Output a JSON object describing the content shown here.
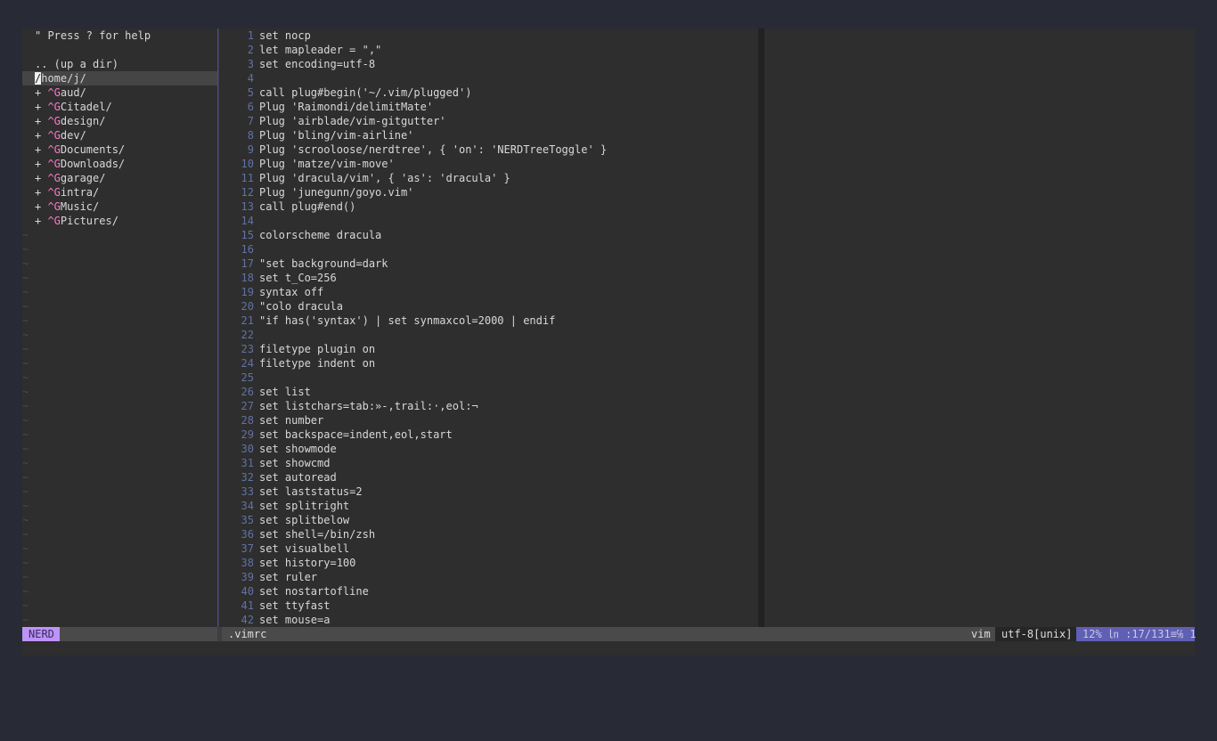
{
  "nerdtree": {
    "help": "\" Press ? for help",
    "up": ".. (up a dir)",
    "root_cursor": "/",
    "root": "home/j/",
    "dirs": [
      "aud/",
      "Citadel/",
      "design/",
      "dev/",
      "Documents/",
      "Downloads/",
      "garage/",
      "intra/",
      "Music/",
      "Pictures/"
    ],
    "prefix": "+ ",
    "ctrl_g": "^G",
    "tilde": "~"
  },
  "code": [
    "set nocp",
    "let mapleader = \",\"",
    "set encoding=utf-8",
    "",
    "call plug#begin('~/.vim/plugged')",
    "Plug 'Raimondi/delimitMate'",
    "Plug 'airblade/vim-gitgutter'",
    "Plug 'bling/vim-airline'",
    "Plug 'scrooloose/nerdtree', { 'on': 'NERDTreeToggle' }",
    "Plug 'matze/vim-move'",
    "Plug 'dracula/vim', { 'as': 'dracula' }",
    "Plug 'junegunn/goyo.vim'",
    "call plug#end()",
    "",
    "colorscheme dracula",
    "",
    "\"set background=dark",
    "set t_Co=256",
    "syntax off",
    "\"colo dracula",
    "\"if has('syntax') | set synmaxcol=2000 | endif",
    "",
    "filetype plugin on",
    "filetype indent on",
    "",
    "set list",
    "set listchars=tab:»-,trail:·,eol:¬",
    "set number",
    "set backspace=indent,eol,start",
    "set showmode",
    "set showcmd",
    "set autoread",
    "set laststatus=2",
    "set splitright",
    "set splitbelow",
    "set shell=/bin/zsh",
    "set visualbell",
    "set history=100",
    "set ruler",
    "set nostartofline",
    "set ttyfast",
    "set mouse=a"
  ],
  "status": {
    "nerd_mode": "NERD",
    "filename": ".vimrc",
    "filetype": "vim",
    "encoding": "utf-8[unix]",
    "position": "12% ㏑ :17/131≡℅ 1"
  },
  "colors": {
    "accent": "#bd93f9",
    "position_bg": "#5f5fb4",
    "line_numbers": "#6272a4",
    "ctrl_g": "#ff79c6"
  }
}
